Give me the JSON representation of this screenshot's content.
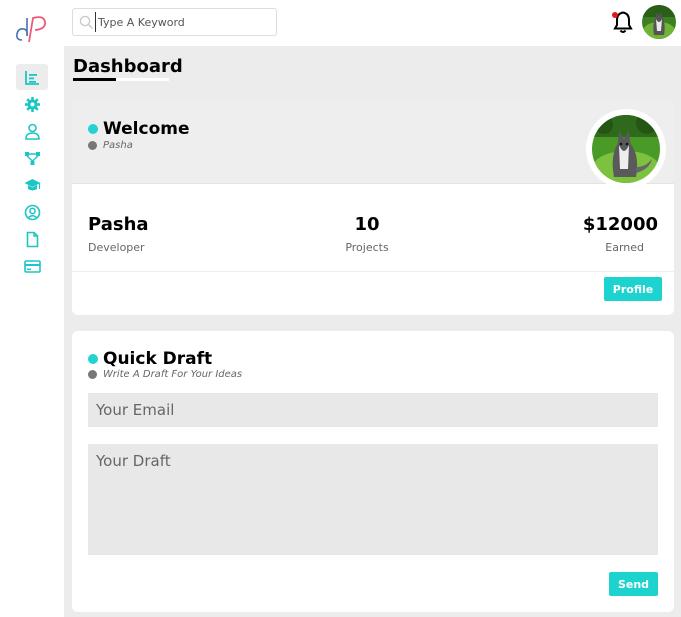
{
  "brand": {
    "logo_text": "dP"
  },
  "sidebar": {
    "items": [
      {
        "icon": "chart-bars-icon",
        "active": true
      },
      {
        "icon": "gear-icon",
        "active": false
      },
      {
        "icon": "user-icon",
        "active": false
      },
      {
        "icon": "diagram-icon",
        "active": false
      },
      {
        "icon": "graduation-cap-icon",
        "active": false
      },
      {
        "icon": "user-circle-icon",
        "active": false
      },
      {
        "icon": "file-icon",
        "active": false
      },
      {
        "icon": "credit-card-icon",
        "active": false
      }
    ]
  },
  "header": {
    "search_placeholder": "Type A Keyword",
    "notification_icon": "bell-icon",
    "notification_dot_color": "#e0181e"
  },
  "page": {
    "title": "Dashboard"
  },
  "welcome": {
    "title": "Welcome",
    "subtitle": "Pasha",
    "name": "Pasha",
    "role": "Developer",
    "projects_value": "10",
    "projects_label": "Projects",
    "earned_value": "$12000",
    "earned_label": "Earned",
    "profile_button": "Profile"
  },
  "quick_draft": {
    "title": "Quick Draft",
    "subtitle": "Write A Draft For Your Ideas",
    "email_placeholder": "Your Email",
    "draft_placeholder": "Your Draft",
    "send_button": "Send"
  },
  "colors": {
    "accent": "#1dd3cf",
    "background": "#ececec"
  }
}
